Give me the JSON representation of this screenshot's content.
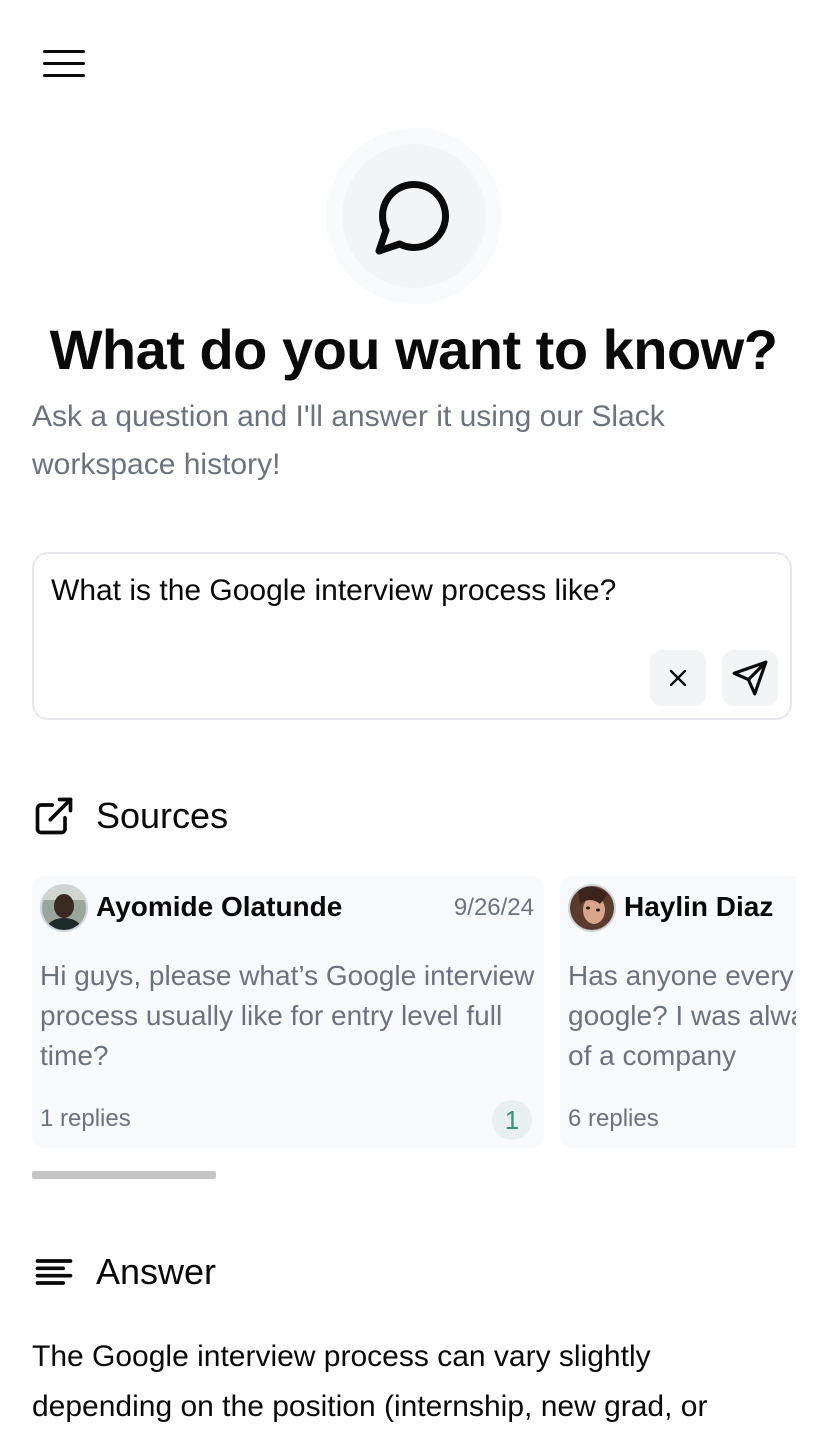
{
  "header": {
    "menu_icon": "hamburger-menu-icon"
  },
  "hero": {
    "icon": "chat-bubble-icon",
    "title": "What do you want to know?",
    "subtitle": "Ask a question and I'll answer it using our Slack workspace history!"
  },
  "query": {
    "value": "What is the Google interview process like?",
    "clear_icon": "close-icon",
    "send_icon": "send-icon"
  },
  "sources": {
    "icon": "external-link-icon",
    "title": "Sources",
    "cards": [
      {
        "author": "Ayomide Olatunde",
        "date": "9/26/24",
        "message": "Hi guys, please what’s Google interview process usually like for entry level full time?",
        "replies": "1 replies",
        "badge": "1"
      },
      {
        "author": "Haylin Diaz",
        "date": "",
        "message": "Has anyone every interviewed at google? I was always curious how huge of a company",
        "replies": "6 replies",
        "badge": ""
      }
    ]
  },
  "answer": {
    "icon": "text-align-left-icon",
    "title": "Answer",
    "text": "The Google interview process can vary slightly depending on the position (internship, new grad, or"
  },
  "colors": {
    "muted_text": "#6b7280",
    "card_bg": "#f8f9fb",
    "badge_bg": "#e7f0ee",
    "badge_text": "#3d8f7a"
  }
}
